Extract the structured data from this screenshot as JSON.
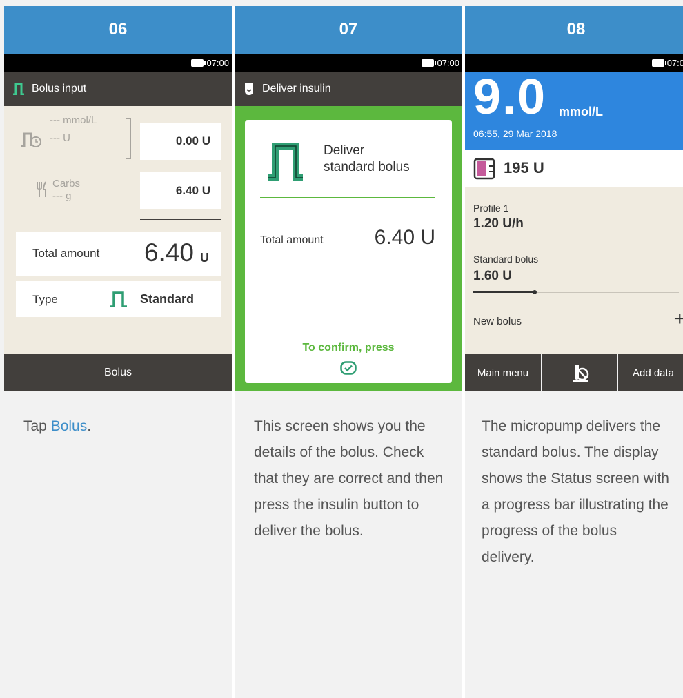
{
  "steps": [
    {
      "number": "06",
      "time": "07:00",
      "screen_title": "Bolus input",
      "bg_mmol": "--- mmol/L",
      "bg_units": "--- U",
      "bg_value": "0.00 U",
      "carbs_label": "Carbs",
      "carbs_grams": "--- g",
      "carbs_value": "6.40 U",
      "total_label": "Total amount",
      "total_value": "6.40",
      "total_unit": "U",
      "type_label": "Type",
      "type_value": "Standard",
      "bottom_button": "Bolus",
      "description_prefix": "Tap ",
      "description_link": "Bolus",
      "description_suffix": "."
    },
    {
      "number": "07",
      "time": "07:00",
      "screen_title": "Deliver insulin",
      "card_title_line1": "Deliver",
      "card_title_line2": "standard bolus",
      "total_label": "Total amount",
      "total_value": "6.40 U",
      "confirm_text": "To confirm, press",
      "description": "This screen shows you the details of the bolus. Check that they are correct and then press the insulin button to deliver the bolus."
    },
    {
      "number": "08",
      "time": "07:0",
      "glucose_value": "9.0",
      "glucose_unit": "mmol/L",
      "glucose_time": "06:55, 29 Mar 2018",
      "reservoir_units": "195 U",
      "profile_label": "Profile 1",
      "basal_rate": "1.20 U/h",
      "bolus_label": "Standard bolus",
      "bolus_value": "1.60 U",
      "bolus_progress": 0.3,
      "new_bolus_label": "New bolus",
      "left_button": "Main menu",
      "right_button": "Add data",
      "description": "The micropump delivers the standard bolus. The display shows the Status screen with a progress bar illustrating the progress of the bolus delivery."
    }
  ],
  "colors": {
    "header_blue": "#3d8ec9",
    "glucose_blue": "#2e86de",
    "accent_green": "#2f9e73",
    "confirm_green": "#5cb83e",
    "dark_bar": "#423f3c",
    "screen_bg": "#f0ebe0",
    "reservoir_pink": "#c45a9a"
  }
}
